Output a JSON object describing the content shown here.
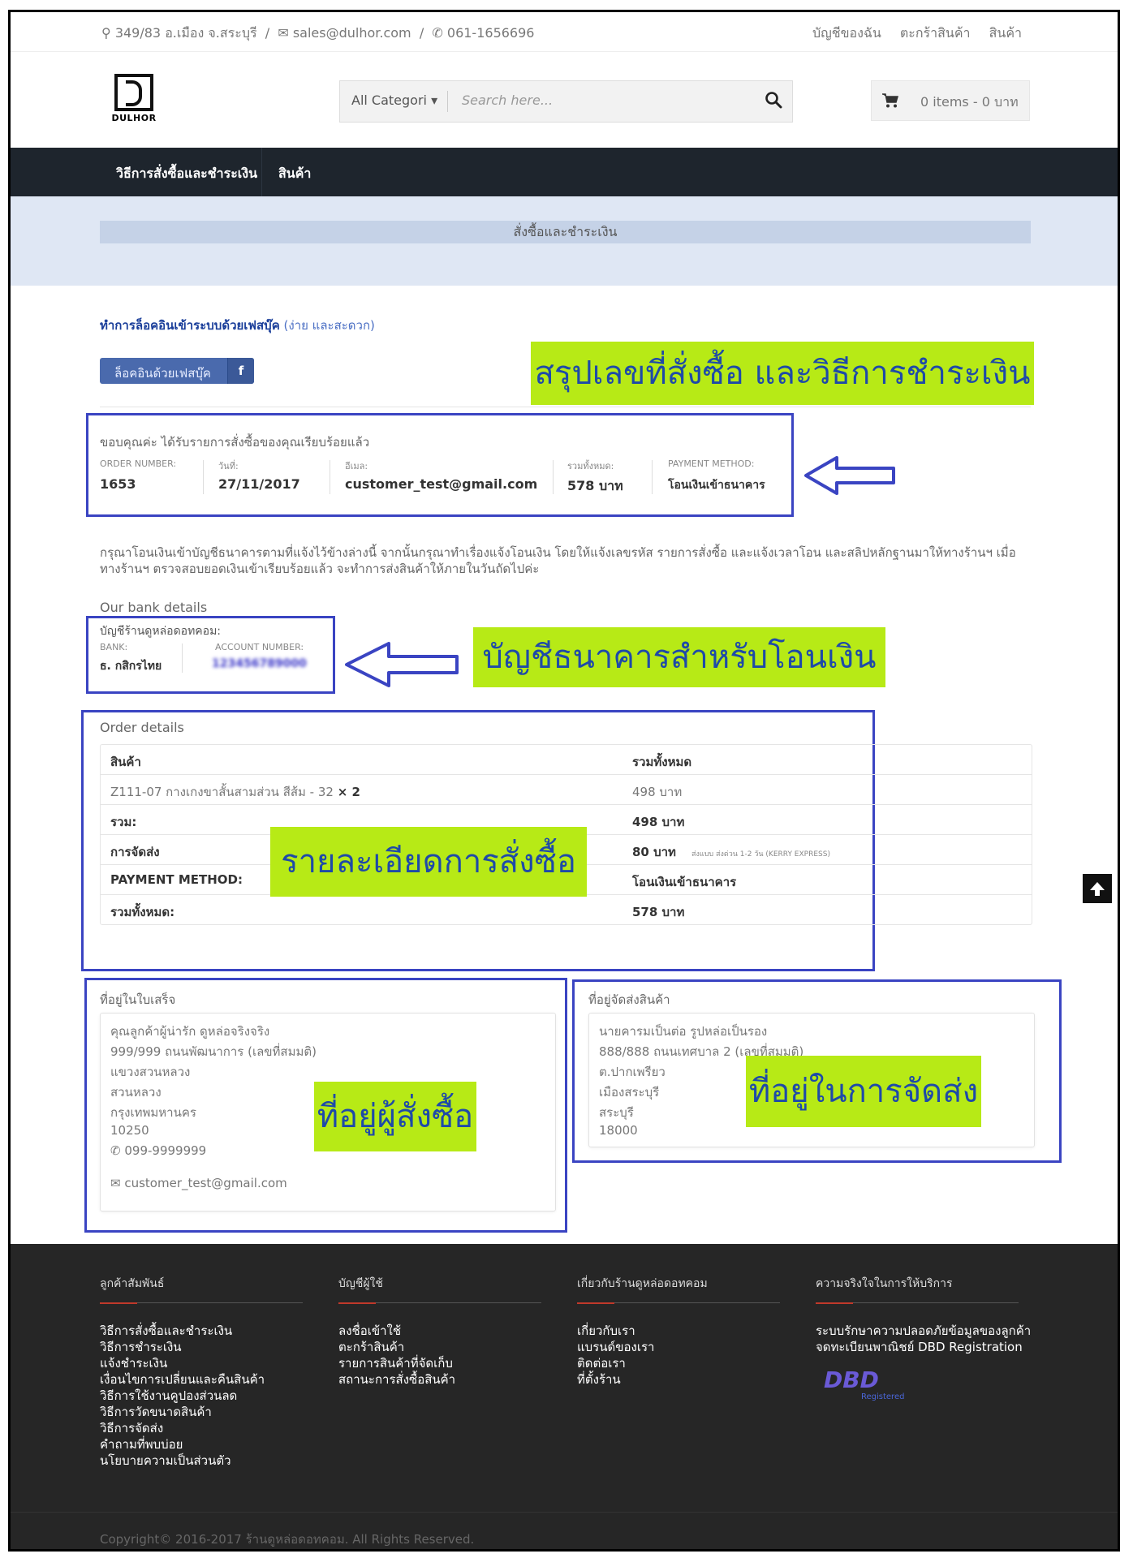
{
  "topbar": {
    "address": "349/83 อ.เมือง จ.สระบุรี",
    "email": "sales@dulhor.com",
    "phone": "061-1656696",
    "links": [
      "บัญชีของฉัน",
      "ตะกร้าสินค้า",
      "สินค้า"
    ]
  },
  "logo": {
    "text": "DULHOR"
  },
  "search": {
    "category": "All Categori",
    "placeholder": "Search here..."
  },
  "cart": {
    "label": "0 items - 0 บาท"
  },
  "nav": {
    "items": [
      "วิธีการสั่งซื้อและชำระเงิน",
      "สินค้า"
    ]
  },
  "page": {
    "title": "สั่งซื้อและชำระเงิน"
  },
  "facebook": {
    "line_bold": "ทำการล็อคอินเข้าระบบด้วยเฟสบุ๊ค",
    "line_extra": " (ง่าย และสะดวก)",
    "button": "ล็อคอินด้วยเฟสบุ๊ค",
    "icon_letter": "f"
  },
  "callouts": {
    "summary": "สรุปเลขที่สั่งซื้อ และวิธีการชำระเงิน",
    "bank": "บัญชีธนาคารสำหรับโอนเงิน",
    "order": "รายละเอียดการสั่งซื้อ",
    "buyer": "ที่อยู่ผู้สั่งซื้อ",
    "shipping": "ที่อยู่ในการจัดส่ง"
  },
  "overview": {
    "thanks": "ขอบคุณค่ะ ได้รับรายการสั่งซื้อของคุณเรียบร้อยแล้ว",
    "order_label": "ORDER NUMBER:",
    "order_value": "1653",
    "date_label": "วันที่:",
    "date_value": "27/11/2017",
    "email_label": "อีเมล:",
    "email_value": "customer_test@gmail.com",
    "total_label": "รวมทั้งหมด:",
    "total_value": "578 บาท",
    "method_label": "PAYMENT METHOD:",
    "method_value": "โอนเงินเข้าธนาคาร"
  },
  "instructions": "กรุณาโอนเงินเข้าบัญชีธนาคารตามที่แจ้งไว้ข้างล่างนี้ จากนั้นกรุณาทำเรื่องแจ้งโอนเงิน โดยให้แจ้งเลขรหัส รายการสั่งซื้อ และแจ้งเวลาโอน และสลิปหลักฐานมาให้ทางร้านฯ เมื่อทางร้านฯ ตรวจสอบยอดเงินเข้าเรียบร้อยแล้ว จะทำการส่งสินค้าให้ภายในวันถัดไปค่ะ",
  "bank": {
    "heading": "Our bank details",
    "account_name": "บัญชีร้านดูหล่อดอทคอม:",
    "bank_label": "BANK:",
    "bank_value": "ธ. กสิกรไทย",
    "account_label": "ACCOUNT NUMBER:",
    "account_value": "123456789000"
  },
  "order": {
    "heading": "Order details",
    "header": [
      "สินค้า",
      "รวมทั้งหมด"
    ],
    "product_name": "Z111-07 กางเกงขาสั้นสามส่วน สีส้ม - 32",
    "product_qty": "× 2",
    "product_total": "498 บาท",
    "subtotal_label": "รวม:",
    "subtotal_value": "498 บาท",
    "shipping_label": "การจัดส่ง",
    "shipping_value": "80 บาท",
    "shipping_note": "ส่งแบบ ส่งด่วน 1-2 วัน (KERRY EXPRESS)",
    "method_label": "PAYMENT METHOD:",
    "method_value": "โอนเงินเข้าธนาคาร",
    "total_label": "รวมทั้งหมด:",
    "total_value": "578 บาท"
  },
  "billing": {
    "heading": "ที่อยู่ในใบเสร็จ",
    "lines": [
      "คุณลูกค้าผู้น่ารัก ดูหล่อจริงจริง",
      "999/999 ถนนพัฒนาการ (เลขที่สมมติ)",
      "แขวงสวนหลวง",
      "สวนหลวง",
      "กรุงเทพมหานคร",
      "10250"
    ],
    "phone": "099-9999999",
    "email": "customer_test@gmail.com"
  },
  "shipping": {
    "heading": "ที่อยู่จัดส่งสินค้า",
    "lines": [
      "นายคารมเป็นต่อ รูปหล่อเป็นรอง",
      "888/888 ถนนเทศบาล 2 (เลขที่สมมติ)",
      "ต.ปากเพรียว",
      "เมืองสระบุรี",
      "สระบุรี",
      "18000"
    ]
  },
  "footer": {
    "cols": [
      {
        "title": "ลูกค้าสัมพันธ์",
        "items": [
          "วิธีการสั่งซื้อและชำระเงิน",
          "วิธีการชำระเงิน",
          "แจ้งชำระเงิน",
          "เงื่อนไขการเปลี่ยนและคืนสินค้า",
          "วิธีการใช้งานคูปองส่วนลด",
          "วิธีการวัดขนาดสินค้า",
          "วิธีการจัดส่ง",
          "คำถามที่พบบ่อย",
          "นโยบายความเป็นส่วนตัว"
        ]
      },
      {
        "title": "บัญชีผู้ใช้",
        "items": [
          "ลงชื่อเข้าใช้",
          "ตะกร้าสินค้า",
          "รายการสินค้าที่จัดเก็บ",
          "สถานะการสั่งซื้อสินค้า"
        ]
      },
      {
        "title": "เกี่ยวกับร้านดูหล่อดอทคอม",
        "items": [
          "เกี่ยวกับเรา",
          "แบรนด์ของเรา",
          "ติดต่อเรา",
          "ที่ตั้งร้าน"
        ]
      },
      {
        "title": "ความจริงใจในการให้บริการ",
        "items": [
          "ระบบรักษาความปลอดภัยข้อมูลของลูกค้า",
          "จดทะเบียนพาณิชย์ DBD Registration"
        ]
      }
    ],
    "dbd_logo": "DBD",
    "dbd_sub": "Registered",
    "copyright": "Copyright© 2016-2017 ร้านดูหล่อดอทคอม. All Rights Reserved."
  }
}
